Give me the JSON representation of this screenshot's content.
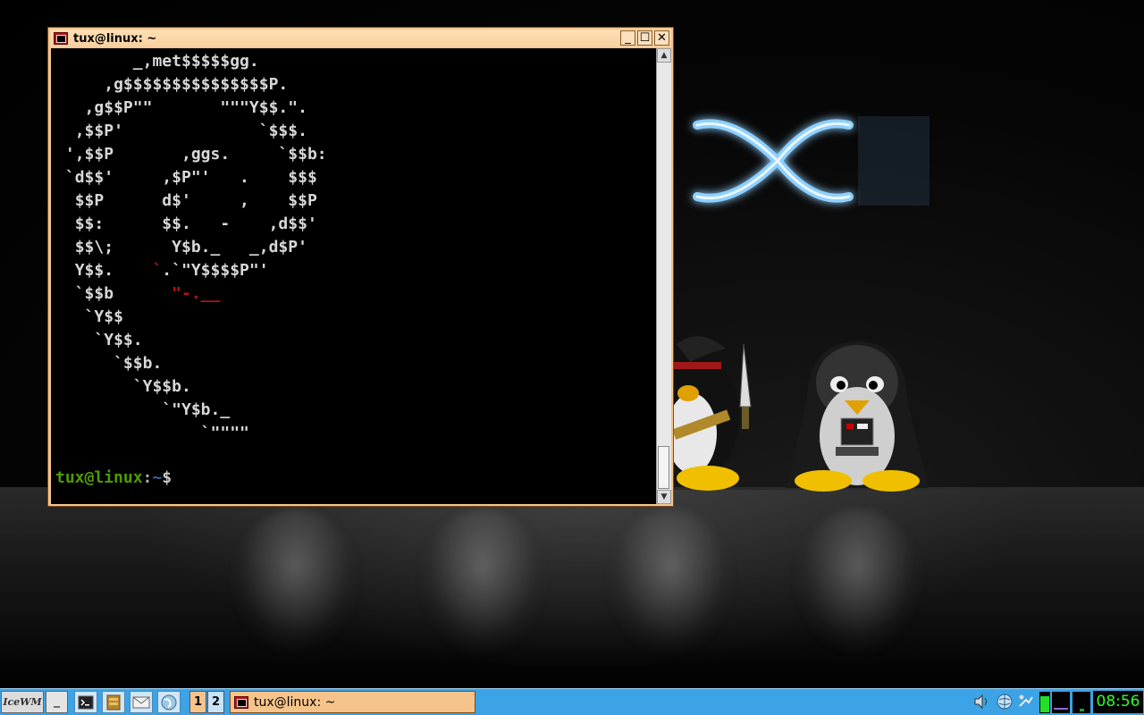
{
  "window": {
    "title": "tux@linux: ~",
    "controls": {
      "minimize": "_",
      "maximize": "☐",
      "close": "✕"
    }
  },
  "terminal": {
    "ascii_lines": [
      "        _,met$$$$$gg.",
      "     ,g$$$$$$$$$$$$$$$P.",
      "   ,g$$P\"\"       \"\"\"Y$$.\".",
      "  ,$$P'              `$$$.",
      " ',$$P       ,ggs.     `$$b:",
      " `d$$'     ,$P\"'   .    $$$",
      "  $$P      d$'     ,    $$P",
      "  $$:      $$.   -    ,d$$'",
      "  $$\\;      Y$b._   _,d$P'",
      "  Y$$.    `.`\"Y$$$$P\"'",
      "  `$$b      \"-.__",
      "   `Y$$",
      "    `Y$$.",
      "      `$$b.",
      "        `Y$$b.",
      "           `\"Y$b._",
      "               `\"\"\"\""
    ],
    "prompt": {
      "user_host": "tux@linux",
      "colon": ":",
      "path": "~",
      "sign": "$"
    }
  },
  "taskbar": {
    "start_label": "IceWM",
    "show_desktop": "_",
    "quick_launch": [
      "terminal-icon",
      "file-manager-icon",
      "mail-icon",
      "web-browser-icon"
    ],
    "workspaces": [
      "1",
      "2"
    ],
    "active_workspace": "1",
    "task": {
      "label": "tux@linux: ~"
    },
    "tray": [
      "volume-icon",
      "network-icon",
      "connection-icon",
      "cpu-monitor-icon",
      "net-monitor-icon",
      "mail-status-icon"
    ],
    "clock": "08:56"
  },
  "colors": {
    "window_frame": "#f6c48b",
    "taskbar": "#3ba3e6",
    "prompt_user": "#4e9a06",
    "prompt_path": "#3465a4",
    "swirl_red": "#c01010",
    "clock_text": "#2aff2a"
  }
}
